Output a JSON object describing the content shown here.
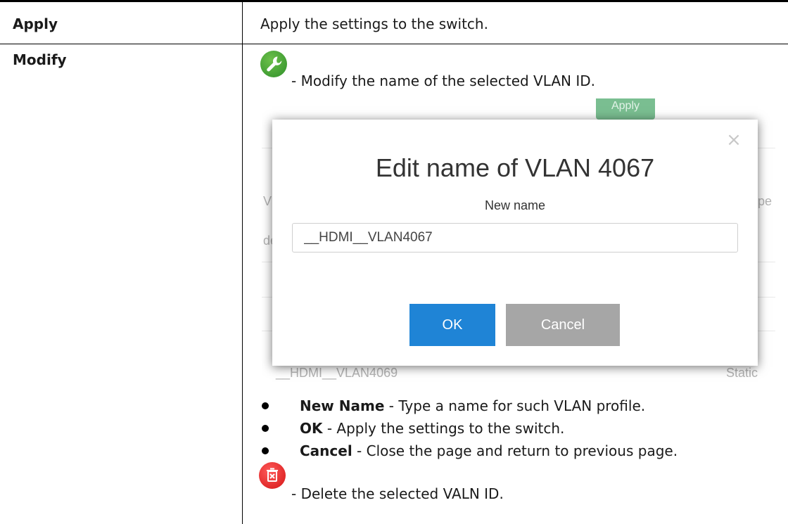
{
  "rows": [
    {
      "term": "Apply",
      "description": "Apply the settings to the switch."
    },
    {
      "term": "Modify",
      "description": "- Modify the name of the selected VLAN ID."
    }
  ],
  "icons": {
    "modify": "wrench-icon",
    "delete": "trash-icon",
    "modify_color": "#3e9e35",
    "delete_color": "#e02020"
  },
  "dialog": {
    "background_apply_label": "Apply",
    "background_header_left": "Vl",
    "background_header_right": "pe",
    "background_row_prefix": "de",
    "background_bottom_row": "__HDMI__VLAN4069",
    "background_bottom_type": "Static",
    "title": "Edit name of VLAN 4067",
    "field_label": "New name",
    "field_value": "__HDMI__VLAN4067",
    "ok_label": "OK",
    "cancel_label": "Cancel",
    "close_symbol": "×",
    "ok_color": "#1f84d6",
    "cancel_color": "#a6a6a6"
  },
  "bullets": [
    {
      "term": "New Name",
      "text": " - Type a name for such VLAN profile."
    },
    {
      "term": "OK",
      "text": " - Apply the settings to the switch."
    },
    {
      "term": "Cancel",
      "text": " - Close the page and return to previous page."
    }
  ],
  "delete_description": "- Delete the selected VALN ID."
}
